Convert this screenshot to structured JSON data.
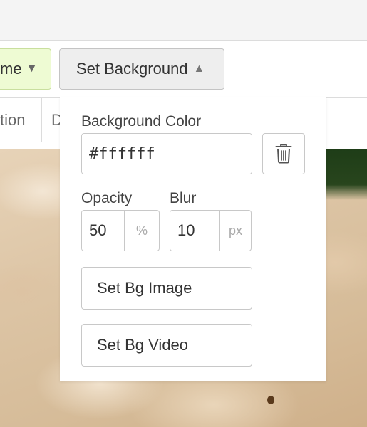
{
  "toolbar": {
    "frame_button_label": "me",
    "background_button_label": "Set Background"
  },
  "subbar": {
    "tab_a_label": "tion",
    "tab_b_label": "D"
  },
  "popup": {
    "bg_color_label": "Background Color",
    "bg_color_value": "#ffffff",
    "swatch_color": "#ffffff",
    "opacity_label": "Opacity",
    "opacity_value": "50",
    "opacity_unit": "%",
    "blur_label": "Blur",
    "blur_value": "10",
    "blur_unit": "px",
    "set_image_label": "Set Bg Image",
    "set_video_label": "Set Bg Video"
  },
  "colors": {
    "accent_green_bg": "#eefbd3",
    "button_bg": "#eeeeee",
    "border": "#c8c8c8"
  },
  "icons": {
    "caret_down": "caret-down-icon",
    "caret_up": "caret-up-icon",
    "trash": "trash-icon"
  }
}
